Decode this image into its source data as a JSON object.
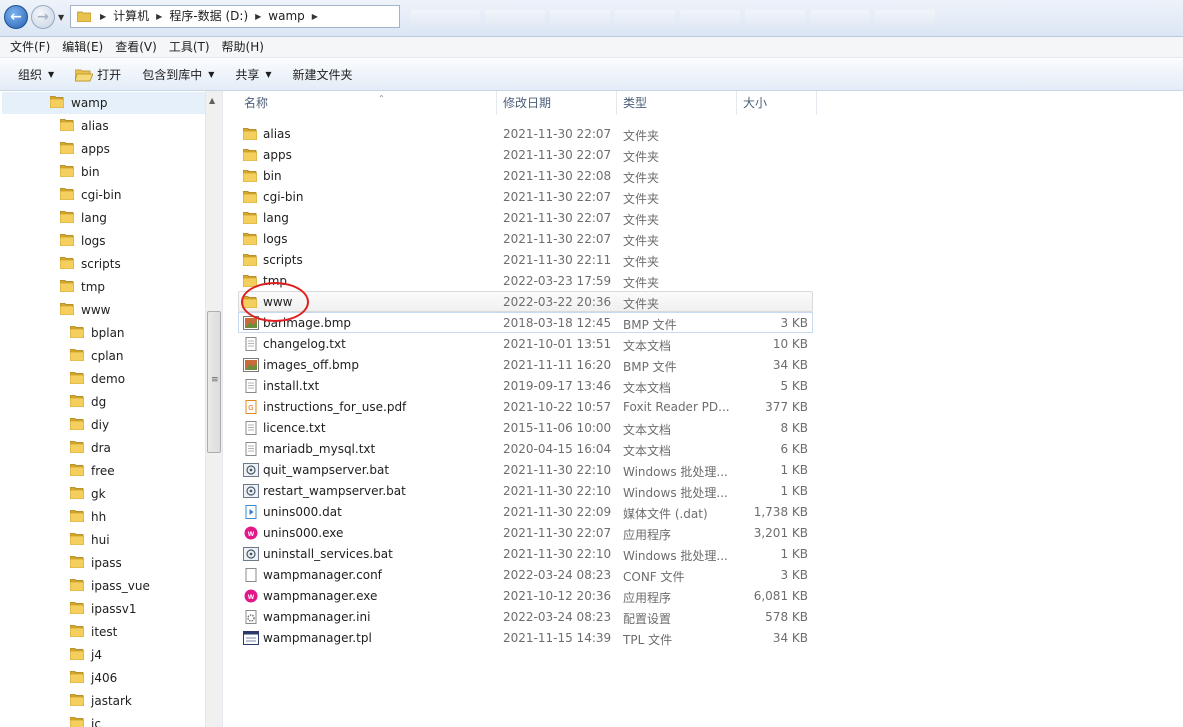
{
  "breadcrumb": [
    "计算机",
    "程序-数据 (D:)",
    "wamp"
  ],
  "menu": [
    "文件(F)",
    "编辑(E)",
    "查看(V)",
    "工具(T)",
    "帮助(H)"
  ],
  "toolbar": {
    "organize": "组织",
    "open": "打开",
    "include": "包含到库中",
    "share": "共享",
    "new_folder": "新建文件夹"
  },
  "nav": {
    "root": "wamp",
    "children": [
      "alias",
      "apps",
      "bin",
      "cgi-bin",
      "lang",
      "logs",
      "scripts",
      "tmp",
      "www"
    ],
    "www_children": [
      "bplan",
      "cplan",
      "demo",
      "dg",
      "diy",
      "dra",
      "free",
      "gk",
      "hh",
      "hui",
      "ipass",
      "ipass_vue",
      "ipassv1",
      "itest",
      "j4",
      "j406",
      "jastark",
      "jc"
    ]
  },
  "columns": {
    "name": "名称",
    "date": "修改日期",
    "type": "类型",
    "size": "大小"
  },
  "files": [
    {
      "name": "alias",
      "date": "2021-11-30 22:07",
      "type": "文件夹",
      "size": "",
      "icon": "folder"
    },
    {
      "name": "apps",
      "date": "2021-11-30 22:07",
      "type": "文件夹",
      "size": "",
      "icon": "folder"
    },
    {
      "name": "bin",
      "date": "2021-11-30 22:08",
      "type": "文件夹",
      "size": "",
      "icon": "folder"
    },
    {
      "name": "cgi-bin",
      "date": "2021-11-30 22:07",
      "type": "文件夹",
      "size": "",
      "icon": "folder"
    },
    {
      "name": "lang",
      "date": "2021-11-30 22:07",
      "type": "文件夹",
      "size": "",
      "icon": "folder"
    },
    {
      "name": "logs",
      "date": "2021-11-30 22:07",
      "type": "文件夹",
      "size": "",
      "icon": "folder"
    },
    {
      "name": "scripts",
      "date": "2021-11-30 22:11",
      "type": "文件夹",
      "size": "",
      "icon": "folder"
    },
    {
      "name": "tmp",
      "date": "2022-03-23 17:59",
      "type": "文件夹",
      "size": "",
      "icon": "folder"
    },
    {
      "name": "www",
      "date": "2022-03-22 20:36",
      "type": "文件夹",
      "size": "",
      "icon": "folder"
    },
    {
      "name": "barimage.bmp",
      "date": "2018-03-18 12:45",
      "type": "BMP 文件",
      "size": "3 KB",
      "icon": "bmp"
    },
    {
      "name": "changelog.txt",
      "date": "2021-10-01 13:51",
      "type": "文本文档",
      "size": "10 KB",
      "icon": "txt"
    },
    {
      "name": "images_off.bmp",
      "date": "2021-11-11 16:20",
      "type": "BMP 文件",
      "size": "34 KB",
      "icon": "bmp"
    },
    {
      "name": "install.txt",
      "date": "2019-09-17 13:46",
      "type": "文本文档",
      "size": "5 KB",
      "icon": "txt"
    },
    {
      "name": "instructions_for_use.pdf",
      "date": "2021-10-22 10:57",
      "type": "Foxit Reader PD...",
      "size": "377 KB",
      "icon": "pdf"
    },
    {
      "name": "licence.txt",
      "date": "2015-11-06 10:00",
      "type": "文本文档",
      "size": "8 KB",
      "icon": "txt"
    },
    {
      "name": "mariadb_mysql.txt",
      "date": "2020-04-15 16:04",
      "type": "文本文档",
      "size": "6 KB",
      "icon": "txt"
    },
    {
      "name": "quit_wampserver.bat",
      "date": "2021-11-30 22:10",
      "type": "Windows 批处理...",
      "size": "1 KB",
      "icon": "bat"
    },
    {
      "name": "restart_wampserver.bat",
      "date": "2021-11-30 22:10",
      "type": "Windows 批处理...",
      "size": "1 KB",
      "icon": "bat"
    },
    {
      "name": "unins000.dat",
      "date": "2021-11-30 22:09",
      "type": "媒体文件 (.dat)",
      "size": "1,738 KB",
      "icon": "dat"
    },
    {
      "name": "unins000.exe",
      "date": "2021-11-30 22:07",
      "type": "应用程序",
      "size": "3,201 KB",
      "icon": "exe"
    },
    {
      "name": "uninstall_services.bat",
      "date": "2021-11-30 22:10",
      "type": "Windows 批处理...",
      "size": "1 KB",
      "icon": "bat"
    },
    {
      "name": "wampmanager.conf",
      "date": "2022-03-24 08:23",
      "type": "CONF 文件",
      "size": "3 KB",
      "icon": "blank"
    },
    {
      "name": "wampmanager.exe",
      "date": "2021-10-12 20:36",
      "type": "应用程序",
      "size": "6,081 KB",
      "icon": "exe"
    },
    {
      "name": "wampmanager.ini",
      "date": "2022-03-24 08:23",
      "type": "配置设置",
      "size": "578 KB",
      "icon": "ini"
    },
    {
      "name": "wampmanager.tpl",
      "date": "2021-11-15 14:39",
      "type": "TPL 文件",
      "size": "34 KB",
      "icon": "tpl"
    }
  ],
  "hovered_row": "www",
  "selected_row": "barimage.bmp",
  "annotation_color": "#e02020"
}
